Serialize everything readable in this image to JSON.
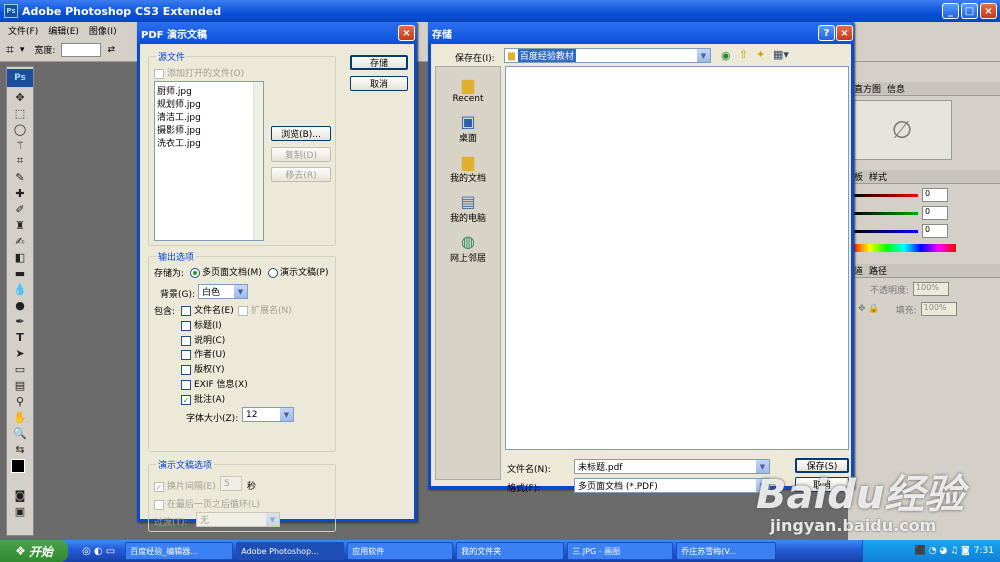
{
  "photoshop": {
    "title": "Adobe Photoshop CS3 Extended",
    "menus": [
      "文件(F)",
      "编辑(E)",
      "图像(I)"
    ],
    "options": {
      "width_label": "宽度:",
      "swap_icon": "⇄"
    },
    "logo": "Ps",
    "right_panel": {
      "tabs1": [
        "直方图",
        "信息"
      ],
      "tabs2": [
        "板",
        "样式"
      ],
      "color_values": [
        "0",
        "0",
        "0"
      ],
      "tabs3": [
        "道",
        "路径"
      ],
      "opacity_label": "不透明度:",
      "opacity_value": "100%",
      "fill_label": "填充:",
      "fill_value": "100%"
    }
  },
  "pdf_dialog": {
    "title": "PDF 演示文稿",
    "source_legend": "源文件",
    "add_open_files": "添加打开的文件(O)",
    "files": [
      "厨师.jpg",
      "规划师.jpg",
      "清洁工.jpg",
      "摄影师.jpg",
      "洗衣工.jpg"
    ],
    "browse": "浏览(B)...",
    "duplicate": "复制(D)",
    "remove": "移去(R)",
    "save_btn": "存储",
    "cancel_btn": "取消",
    "output_legend": "输出选项",
    "save_as_label": "存储为:",
    "multi_page": "多页面文档(M)",
    "presentation": "演示文稿(P)",
    "bg_label": "背景(G):",
    "bg_value": "白色",
    "include_label": "包含:",
    "options": {
      "filename": "文件名(E)",
      "extension": "扩展名(N)",
      "title": "标题(I)",
      "description": "说明(C)",
      "author": "作者(U)",
      "copyright": "版权(Y)",
      "exif": "EXIF 信息(X)",
      "annotation": "批注(A)"
    },
    "font_size_label": "字体大小(Z):",
    "font_size_value": "12",
    "slideshow_legend": "演示文稿选项",
    "advance": "换片间隔(E)",
    "advance_value": "5",
    "seconds": "秒",
    "loop": "在最后一页之后循环(L)",
    "transition_label": "过渡(T):",
    "transition_value": "无"
  },
  "save_dialog": {
    "title": "存储",
    "save_in_label": "保存在(I):",
    "save_in_value": "百度经验教材",
    "places": [
      "Recent",
      "桌面",
      "我的文档",
      "我的电脑",
      "网上邻居"
    ],
    "filename_label": "文件名(N):",
    "filename_value": "未标题.pdf",
    "format_label": "格式(F):",
    "format_value": "多页面文档 (*.PDF)",
    "save_btn": "保存(S)",
    "cancel_btn": "取消"
  },
  "taskbar": {
    "start": "开始",
    "tasks": [
      "百度经验_编辑器...",
      "Adobe Photoshop...",
      "应用软件",
      "我的文件夹",
      "三.JPG - 画图",
      "乔庄苏雪梅(V..."
    ],
    "time": "7:31"
  },
  "watermark": {
    "brand": "Baidu经验",
    "url": "jingyan.baidu.com"
  }
}
